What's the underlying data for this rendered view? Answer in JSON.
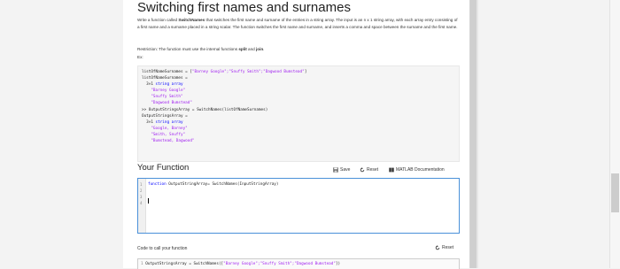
{
  "problem": {
    "title": "Switching first names and surnames",
    "para1_a": "Write a function called ",
    "para1_b": "SwitchNames",
    "para1_c": " that switches the first name and surname of the entries in a string array. The input is an n x 1 string array, with each array entry consisting of a first name and a surname placed in a string scalar. The function switches the first name and surname, and inserts a comma and space between the surname and the first name.",
    "restriction_a": "Restriction: The function must use the internal functions ",
    "restriction_b": "split",
    "restriction_c": " and ",
    "restriction_d": "join",
    "restriction_e": ".",
    "ex_label": "Ex:"
  },
  "example_code": {
    "l1_a": "listOfNameSurnames = [",
    "l1_b": "\"Barney Google\";\"Snuffy Smith\";\"Dagwood Bumstead\"",
    "l1_c": "]",
    "l2": "listOfNameSurnames =",
    "l3_a": "  3×1 ",
    "l3_b": "string array",
    "l4": "    \"Barney Google\"",
    "l5": "    \"Snuffy Smith\"",
    "l6": "    \"Dagwood Bumstead\"",
    "l7": ">> OutputStringsArray = SwitchNames(listOfNameSurnames)",
    "l8": "OutputStringsArray =",
    "l9_a": "  3×1 ",
    "l9_b": "string array",
    "l10": "    \"Google, Barney\"",
    "l11": "    \"Smith, Snuffy\"",
    "l12": "    \"Bumstead, Dagwood\""
  },
  "your_function": {
    "title": "Your Function",
    "save_label": "Save",
    "reset_label": "Reset",
    "doc_label": "MATLAB Documentation",
    "line_numbers": [
      "1",
      "2",
      "3",
      "4"
    ],
    "code_kw": "function",
    "code_rest": " OutputStringArray= SwitchNames(InputStringArray)"
  },
  "call_section": {
    "label": "Code to call your function",
    "reset_label": "Reset",
    "line_number": "1",
    "code_a": "OutputStringsArray = SwitchNames([",
    "code_b": "\"Barney Google\";\"Snuffy Smith\";\"Dagwood Bumstead\"",
    "code_c": "])"
  },
  "colors": {
    "editor_border": "#4a90d9",
    "string": "#a020f0",
    "keyword": "#0000ff"
  }
}
